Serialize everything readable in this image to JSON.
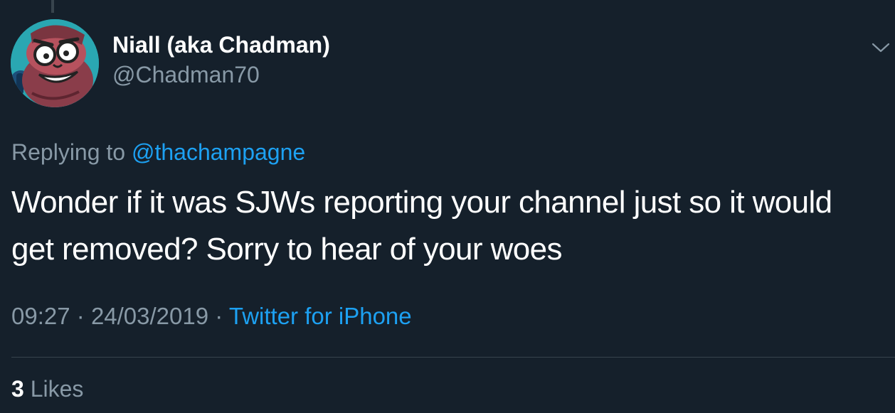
{
  "user": {
    "display_name": "Niall (aka Chadman)",
    "handle": "@Chadman70",
    "avatar_icon": "cartoon-bearded-face-avatar"
  },
  "reply": {
    "prefix": "Replying to",
    "mention": "@thachampagne"
  },
  "tweet": {
    "line1": "Wonder if it was SJWs reporting your channel just so it would",
    "line2": "get removed? Sorry to hear of your woes"
  },
  "meta": {
    "time": "09:27",
    "separator1": "·",
    "date": "24/03/2019",
    "separator2": "·",
    "source": "Twitter for iPhone"
  },
  "stats": {
    "likes_count": "3",
    "likes_label": "Likes"
  },
  "colors": {
    "background": "#15202b",
    "secondary_text": "#8899a6",
    "link": "#1da1f2",
    "divider": "#38444d"
  }
}
